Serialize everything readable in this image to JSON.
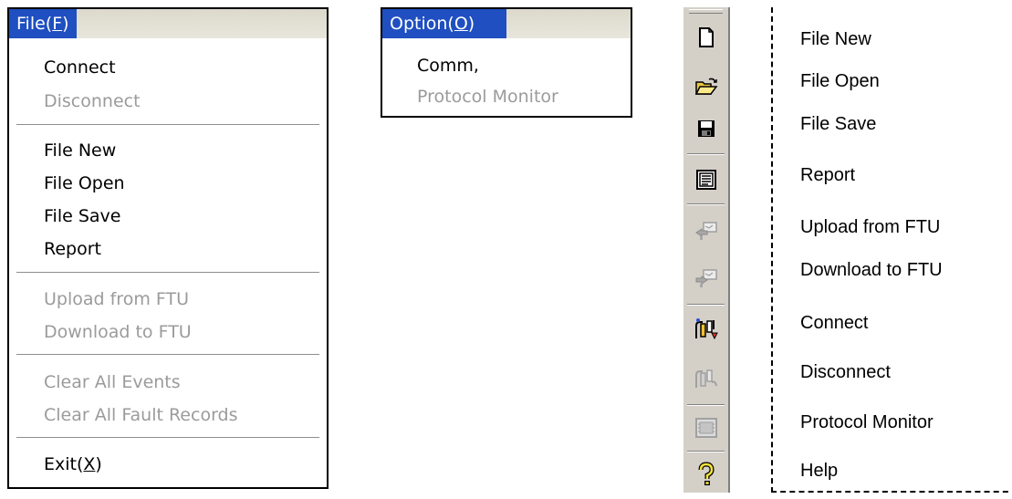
{
  "file_menu": {
    "title": "File(",
    "title_accel": "F",
    "title_end": ")",
    "items": [
      {
        "label": "Connect",
        "enabled": true
      },
      {
        "label": "Disconnect",
        "enabled": false
      },
      {
        "label": "File New",
        "enabled": true
      },
      {
        "label": "File Open",
        "enabled": true
      },
      {
        "label": "File Save",
        "enabled": true
      },
      {
        "label": "Report",
        "enabled": true
      },
      {
        "label": "Upload from FTU",
        "enabled": false
      },
      {
        "label": "Download to FTU",
        "enabled": false
      },
      {
        "label": "Clear All Events",
        "enabled": false
      },
      {
        "label": "Clear All Fault Records",
        "enabled": false
      }
    ],
    "exit_label": "Exit(",
    "exit_accel": "X",
    "exit_end": ")"
  },
  "option_menu": {
    "title": "Option(",
    "title_accel": "O",
    "title_end": ")",
    "items": [
      {
        "label": "Comm,",
        "enabled": true
      },
      {
        "label": "Protocol Monitor",
        "enabled": false
      }
    ]
  },
  "toolbar": {
    "buttons": [
      {
        "icon": "file-new-icon",
        "enabled": true
      },
      {
        "icon": "file-open-icon",
        "enabled": true
      },
      {
        "icon": "file-save-icon",
        "enabled": true
      },
      {
        "icon": "report-icon",
        "enabled": true
      },
      {
        "icon": "upload-icon",
        "enabled": false
      },
      {
        "icon": "download-icon",
        "enabled": false
      },
      {
        "icon": "connect-icon",
        "enabled": true
      },
      {
        "icon": "disconnect-icon",
        "enabled": false
      },
      {
        "icon": "protocol-monitor-icon",
        "enabled": false
      },
      {
        "icon": "help-icon",
        "enabled": true
      }
    ]
  },
  "legend": {
    "items": [
      "File New",
      "File Open",
      "File Save",
      "Report",
      "Upload from FTU",
      "Download to FTU",
      "Connect",
      "Disconnect",
      "Protocol Monitor",
      "Help"
    ]
  },
  "colors": {
    "menu_highlight": "#1f4fc0",
    "disabled_text": "#9b9b9b",
    "toolbar_bg": "#d4d0c8"
  }
}
